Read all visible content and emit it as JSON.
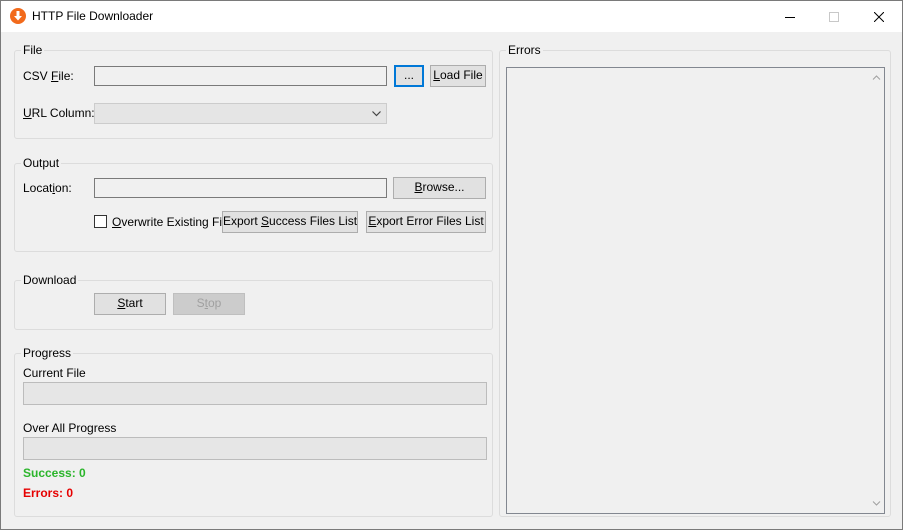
{
  "window": {
    "title": "HTTP File Downloader",
    "icon": "download-arrow-icon",
    "controls": [
      "minimize-icon",
      "maximize-icon",
      "close-icon"
    ]
  },
  "file_group": {
    "title": "File",
    "csv_label_pre": "CSV ",
    "csv_label_u": "F",
    "csv_label_post": "ile:",
    "csv_value": "",
    "browse_csv_label": "...",
    "load_pre": "",
    "load_u": "L",
    "load_post": "oad File",
    "url_label_u": "U",
    "url_label_post": "RL Column:",
    "url_value": ""
  },
  "output_group": {
    "title": "Output",
    "location_label_pre": "Locat",
    "location_label_u": "i",
    "location_label_post": "on:",
    "location_value": "",
    "browse_pre": "",
    "browse_u": "B",
    "browse_post": "rowse...",
    "overwrite_u": "O",
    "overwrite_post": "verwrite Existing File",
    "overwrite_checked": false,
    "export_success_pre": "Export ",
    "export_success_u": "S",
    "export_success_post": "uccess Files List",
    "export_error_pre": "",
    "export_error_u": "E",
    "export_error_post": "xport Error Files List"
  },
  "download_group": {
    "title": "Download",
    "start_pre": "",
    "start_u": "S",
    "start_post": "tart",
    "stop_pre": "S",
    "stop_u": "t",
    "stop_post": "op"
  },
  "progress_group": {
    "title": "Progress",
    "current_file_label": "Current File",
    "current_file_progress": 0,
    "overall_label": "Over All Progress",
    "overall_progress": 0,
    "success_text": "Success: 0",
    "errors_text": "Errors: 0",
    "success_color": "#2bb52b",
    "errors_color": "#e60000"
  },
  "errors_group": {
    "title": "Errors",
    "content": ""
  }
}
